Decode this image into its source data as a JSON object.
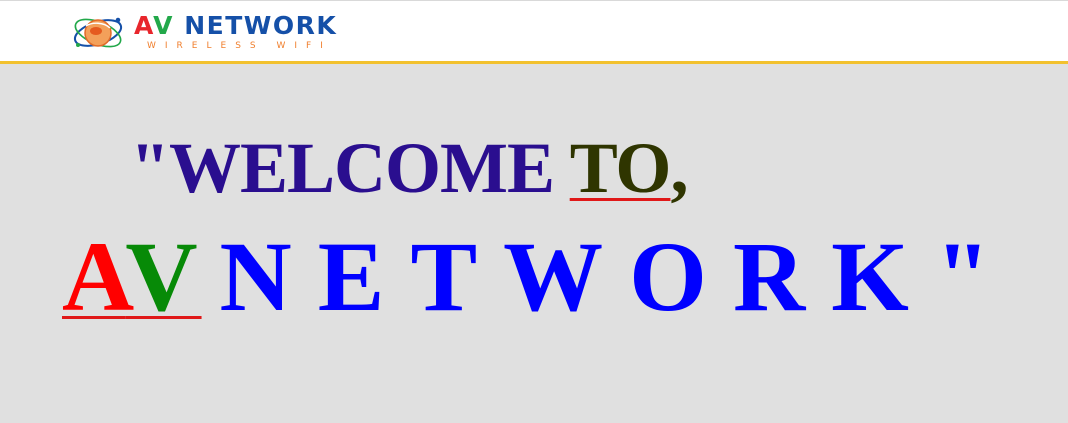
{
  "header": {
    "logo": {
      "icon": "globe-orbit-logo-icon",
      "title_a": "A",
      "title_v": "V",
      "title_rest": " NETWORK",
      "subtitle": "WIRELESS WIFI"
    },
    "rule_color": "#f2c12e"
  },
  "hero": {
    "line1_prefix": "\"WELCOME ",
    "line1_to": "TO",
    "line1_comma": ",",
    "line2_a": "A",
    "line2_v": "V",
    "line2_rest": "NETWORK\""
  },
  "colors": {
    "background": "#e0e0e0",
    "welcome_text": "#2a0e8f",
    "to_text": "#2f3500",
    "underline": "#e01818",
    "letter_a": "#ff0000",
    "letter_v": "#078a07",
    "network_text": "#0000ff",
    "logo_a": "#e8262c",
    "logo_v": "#22a84a",
    "logo_network": "#1550a8",
    "logo_subtitle": "#f07f2d"
  }
}
